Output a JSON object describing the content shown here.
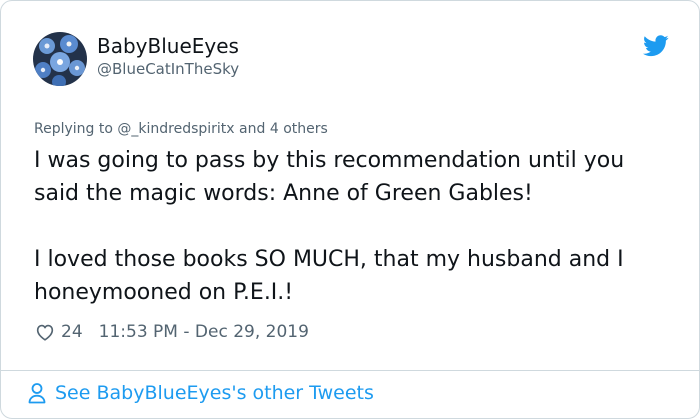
{
  "author": {
    "display_name": "BabyBlueEyes",
    "handle": "@BlueCatInTheSky"
  },
  "reply": {
    "prefix": "Replying to",
    "mention": "@_kindredspiritx",
    "suffix": "and 4 others"
  },
  "tweet": {
    "paragraph_1": "I was going to pass by this recommendation until you said the magic words: Anne of Green Gables!",
    "paragraph_2": "I loved those books SO MUCH, that my husband and I honeymooned on P.E.I.!"
  },
  "meta": {
    "like_count": "24",
    "timestamp": "11:53 PM - Dec 29, 2019"
  },
  "footer": {
    "link_text": "See BabyBlueEyes's other Tweets"
  },
  "icons": {
    "brand": "twitter-bird-icon",
    "like": "heart-icon",
    "profile": "person-icon"
  },
  "colors": {
    "accent": "#1d9bf0",
    "text": "#0f1419",
    "muted": "#536471",
    "border": "#cfd9de"
  }
}
